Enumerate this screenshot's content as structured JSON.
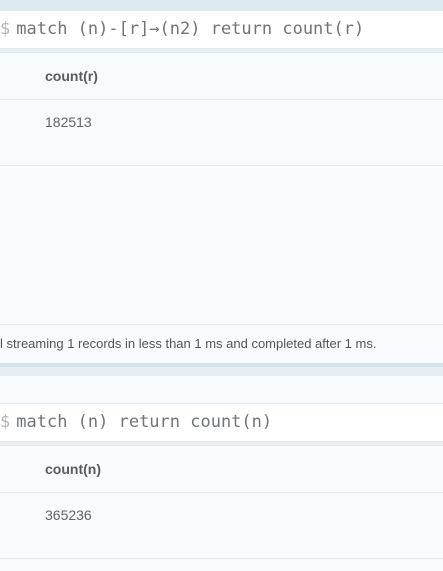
{
  "frames": [
    {
      "prompt": "$",
      "query": "match (n)-[r]→(n2) return count(r)",
      "column_header": "count(r)",
      "cell_value": "182513",
      "status": "l streaming 1 records in less than 1 ms and completed after 1 ms."
    },
    {
      "prompt": "$",
      "query": "match (n) return count(n)",
      "column_header": "count(n)",
      "cell_value": "365236"
    }
  ]
}
